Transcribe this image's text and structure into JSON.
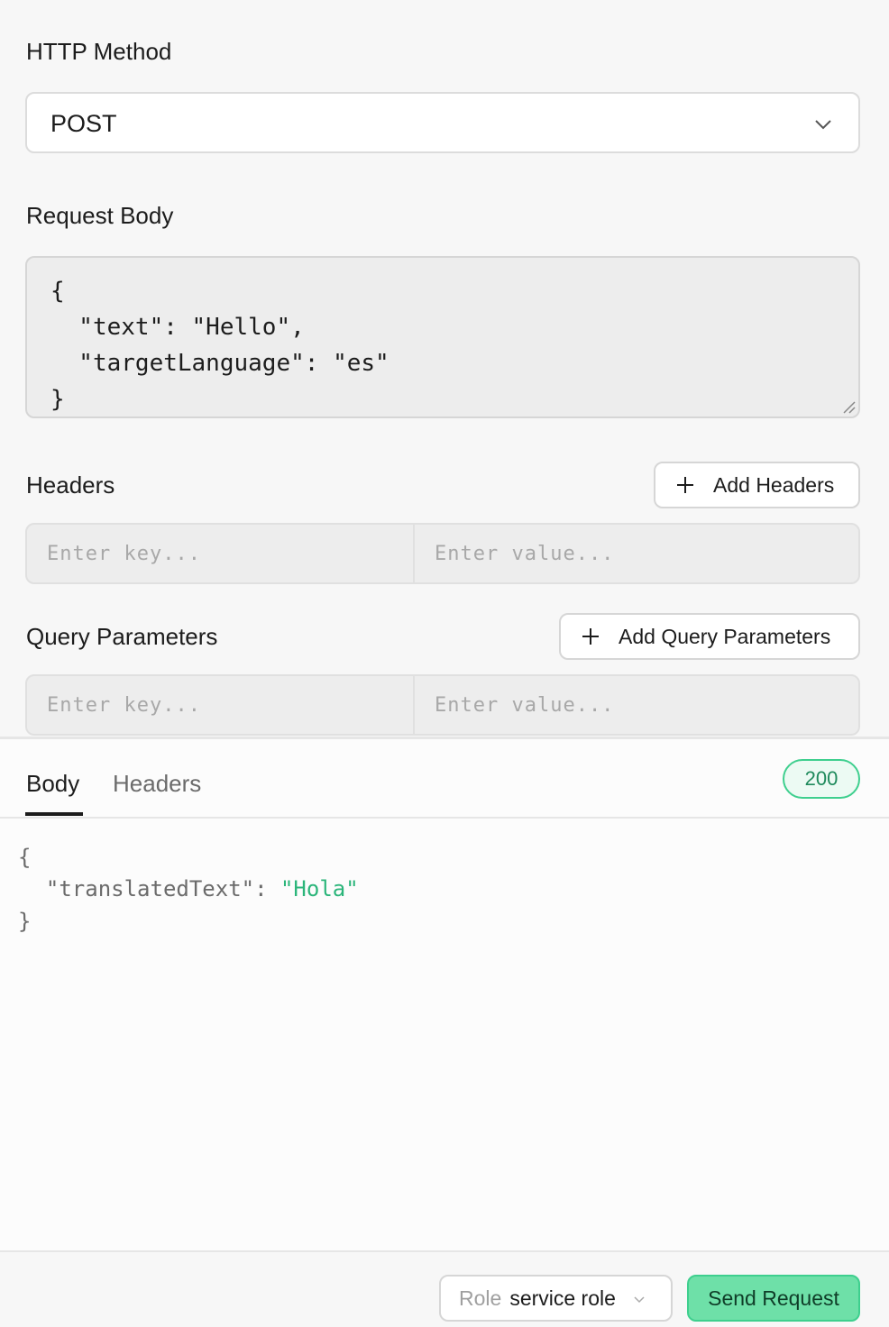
{
  "request": {
    "method_label": "HTTP Method",
    "method_value": "POST",
    "body_label": "Request Body",
    "body_lines": [
      "{",
      "  \"text\": \"Hello\",",
      "  \"targetLanguage\": \"es\"",
      "}"
    ],
    "headers_label": "Headers",
    "add_headers_button": "Add Headers",
    "headers_key_placeholder": "Enter key...",
    "headers_value_placeholder": "Enter value...",
    "query_label": "Query Parameters",
    "add_query_button": "Add Query Parameters",
    "query_key_placeholder": "Enter key...",
    "query_value_placeholder": "Enter value..."
  },
  "response": {
    "tabs": [
      {
        "label": "Body",
        "active": true
      },
      {
        "label": "Headers",
        "active": false
      }
    ],
    "status": "200",
    "body": {
      "open": "{",
      "key": "  \"translatedText\": ",
      "value": "\"Hola\"",
      "close": "}"
    }
  },
  "footer": {
    "role_prefix": "Role",
    "role_value": "service role",
    "send_button": "Send Request"
  },
  "colors": {
    "accent": "#3ecf8e",
    "send_fill": "#6ee0a8",
    "json_string": "#2bb57a"
  },
  "icons": {
    "method_dropdown": "chevron-down-icon",
    "add": "plus-icon",
    "role_dropdown": "chevron-down-icon",
    "resize": "resize-grip-icon"
  }
}
